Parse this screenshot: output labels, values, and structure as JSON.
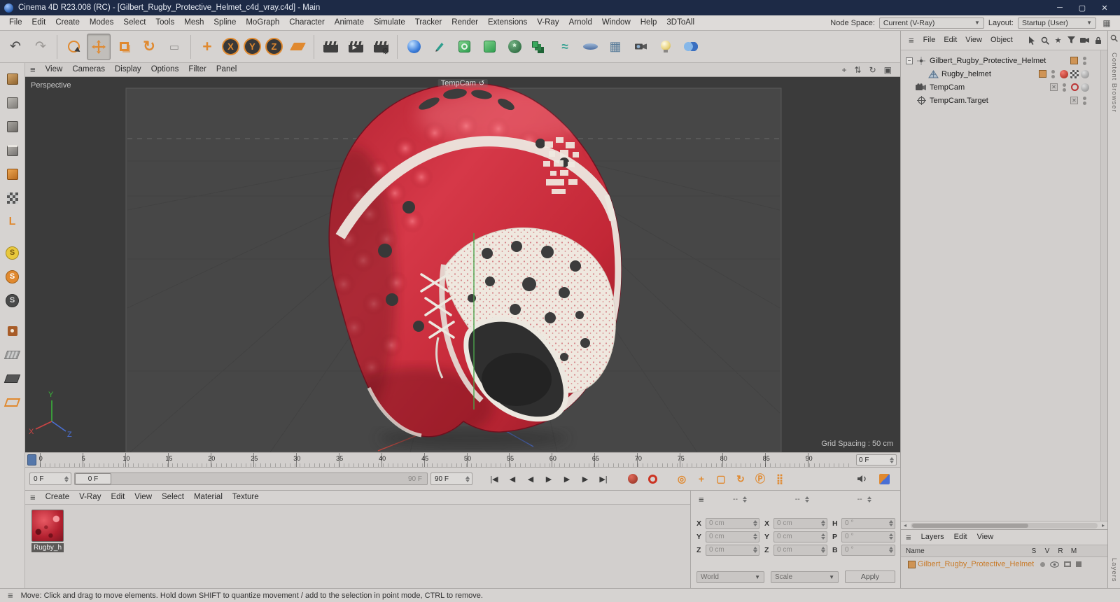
{
  "window": {
    "title": "Cinema 4D R23.008 (RC) - [Gilbert_Rugby_Protective_Helmet_c4d_vray.c4d] - Main"
  },
  "menubar": {
    "items": [
      "File",
      "Edit",
      "Create",
      "Modes",
      "Select",
      "Tools",
      "Mesh",
      "Spline",
      "MoGraph",
      "Character",
      "Animate",
      "Simulate",
      "Tracker",
      "Render",
      "Extensions",
      "V-Ray",
      "Arnold",
      "Window",
      "Help",
      "3DToAll"
    ],
    "node_space_label": "Node Space:",
    "node_space_value": "Current (V-Ray)",
    "layout_label": "Layout:",
    "layout_value": "Startup (User)"
  },
  "toolbar": {
    "icons": [
      "undo",
      "redo",
      "live-selection",
      "move-tool",
      "scale-tool",
      "rotate-tool",
      "last-tool",
      "coordinate-system",
      "lock-x",
      "lock-y",
      "lock-z",
      "workplane",
      "render-view",
      "render-picture-viewer",
      "render-settings",
      "add-primitive",
      "spline-pen",
      "subdivision-surface",
      "generator",
      "volume",
      "mograph-cloner",
      "fields",
      "floor",
      "array",
      "motion-camera",
      "light",
      "sky"
    ],
    "axis_locks": [
      {
        "label": "X",
        "name": "lock-x-button"
      },
      {
        "label": "Y",
        "name": "lock-y-button"
      },
      {
        "label": "Z",
        "name": "lock-z-button"
      }
    ]
  },
  "palette": {
    "icons": [
      "make-editable",
      "model-mode",
      "point-mode",
      "edge-mode",
      "polygon-mode",
      "texture-mode",
      "axis-mode",
      "snap-enable",
      "snap-modes",
      "snap-settings",
      "paint-tool",
      "workplane-mode",
      "locked-workplane",
      "reset-workplane"
    ]
  },
  "viewport": {
    "menu": [
      "View",
      "Cameras",
      "Display",
      "Options",
      "Filter",
      "Panel"
    ],
    "projection": "Perspective",
    "camera_label": "TempCam",
    "grid_spacing": "Grid Spacing : 50 cm",
    "axis_labels": {
      "x": "X",
      "y": "Y",
      "z": "Z"
    },
    "nav_icons": [
      "pan",
      "dolly",
      "orbit",
      "toggle-view"
    ]
  },
  "timeline": {
    "ticks": [
      "0",
      "5",
      "10",
      "15",
      "20",
      "25",
      "30",
      "35",
      "40",
      "45",
      "50",
      "55",
      "60",
      "65",
      "70",
      "75",
      "80",
      "85",
      "90"
    ],
    "frame_field": "0 F"
  },
  "transport": {
    "start_field": "0 F",
    "slider_handle": "0 F",
    "slider_end": "90 F",
    "end_field": "90 F",
    "buttons": [
      {
        "name": "goto-start-button",
        "glyph": "|◀"
      },
      {
        "name": "prev-key-button",
        "glyph": "◀"
      },
      {
        "name": "prev-frame-button",
        "glyph": "◀"
      },
      {
        "name": "play-forwards-button",
        "glyph": "▶"
      },
      {
        "name": "next-frame-button",
        "glyph": "▶"
      },
      {
        "name": "next-key-button",
        "glyph": "▶"
      },
      {
        "name": "goto-end-button",
        "glyph": "▶|"
      }
    ],
    "toggle_icons": [
      "record-button",
      "autokeying-button",
      "keyframe-selection-button",
      "record-position-toggle",
      "record-scale-toggle",
      "record-rotation-toggle",
      "record-parameter-toggle",
      "record-pla-toggle",
      "sound-toggle",
      "render-split-toggle"
    ]
  },
  "materials": {
    "menu": [
      "Create",
      "V-Ray",
      "Edit",
      "View",
      "Select",
      "Material",
      "Texture"
    ],
    "items": [
      {
        "name": "Rugby_h"
      }
    ]
  },
  "coordinates": {
    "groups": [
      {
        "header": "--",
        "rows": [
          {
            "label": "X",
            "value": "0 cm"
          },
          {
            "label": "Y",
            "value": "0 cm"
          },
          {
            "label": "Z",
            "value": "0 cm"
          }
        ]
      },
      {
        "header": "--",
        "rows": [
          {
            "label": "X",
            "value": "0 cm"
          },
          {
            "label": "Y",
            "value": "0 cm"
          },
          {
            "label": "Z",
            "value": "0 cm"
          }
        ]
      },
      {
        "header": "--",
        "rows": [
          {
            "label": "H",
            "value": "0 °"
          },
          {
            "label": "P",
            "value": "0 °"
          },
          {
            "label": "B",
            "value": "0 °"
          }
        ]
      }
    ],
    "world_value": "World",
    "scale_value": "Scale",
    "apply_label": "Apply"
  },
  "object_manager": {
    "menu": [
      "File",
      "Edit",
      "View",
      "Object"
    ],
    "header_icons": [
      "select",
      "search",
      "bookmark",
      "filter",
      "camera",
      "lock"
    ],
    "items": [
      {
        "name": "Gilbert_Rugby_Protective_Helmet"
      },
      {
        "name": "Rugby_helmet"
      },
      {
        "name": "TempCam"
      },
      {
        "name": "TempCam.Target"
      }
    ]
  },
  "layers_panel": {
    "menu": [
      "Layers",
      "Edit",
      "View"
    ],
    "name_header": "Name",
    "columns": [
      "S",
      "V",
      "R",
      "M"
    ],
    "items": [
      {
        "name": "Gilbert_Rugby_Protective_Helmet"
      }
    ]
  },
  "side_tabs": {
    "top": "Content Browser",
    "bottom": "Layers"
  },
  "statusbar": {
    "text": "Move: Click and drag to move elements. Hold down SHIFT to quantize movement / add to the selection in point mode, CTRL to remove."
  },
  "colors": {
    "titlebar": "#1d2a46",
    "accent_orange": "#e0892f",
    "helmet_red": "#cf2e3e",
    "layer_orange": "#c87a28"
  }
}
